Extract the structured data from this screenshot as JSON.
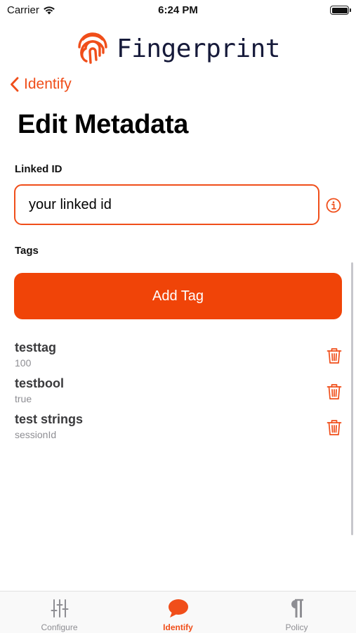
{
  "status_bar": {
    "carrier": "Carrier",
    "time": "6:24 PM",
    "battery_level": 1.0
  },
  "app": {
    "brand_name": "Fingerprint"
  },
  "nav": {
    "back_label": "Identify"
  },
  "page": {
    "title": "Edit Metadata"
  },
  "form": {
    "linked_id_label": "Linked ID",
    "linked_id_value": "your linked id",
    "tags_label": "Tags",
    "add_tag_label": "Add Tag"
  },
  "tags": [
    {
      "name": "testtag",
      "value": "100"
    },
    {
      "name": "testbool",
      "value": "true"
    },
    {
      "name": "test strings",
      "value": "sessionId"
    }
  ],
  "tab_bar": {
    "tabs": [
      {
        "label": "Configure",
        "icon": "sliders-icon",
        "active": false
      },
      {
        "label": "Identify",
        "icon": "speech-bubble-icon",
        "active": true
      },
      {
        "label": "Policy",
        "icon": "pilcrow-icon",
        "active": false
      }
    ]
  },
  "colors": {
    "accent": "#f04e1a",
    "button": "#f04408",
    "brand_text": "#161a3a",
    "secondary_text": "#8e8e93"
  }
}
